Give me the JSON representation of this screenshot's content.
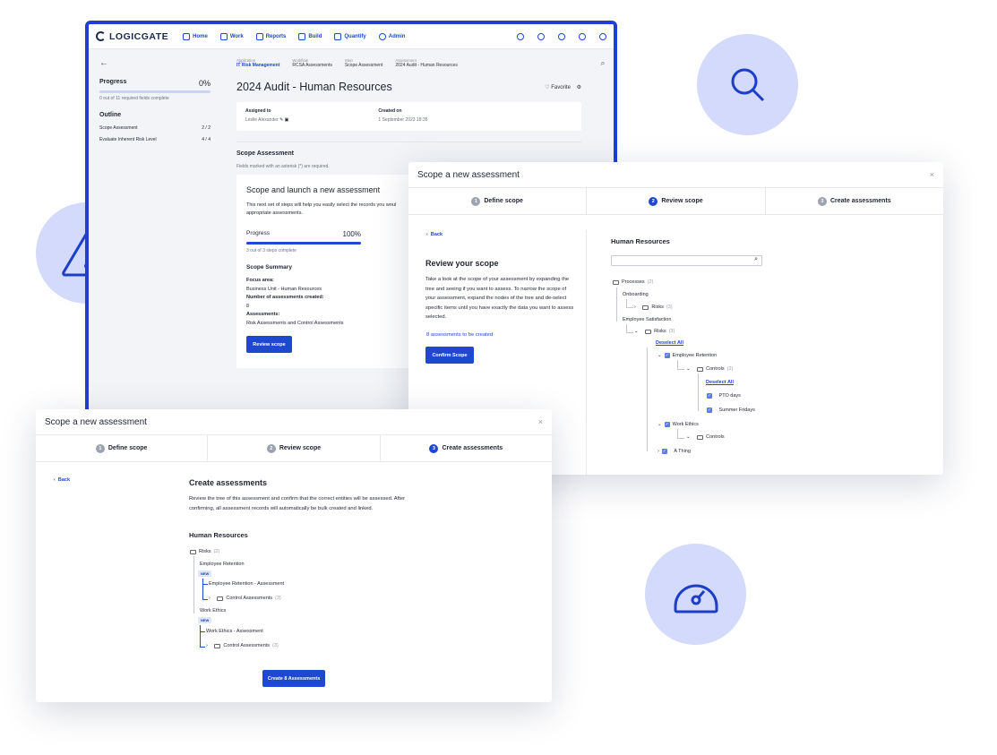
{
  "app": {
    "logo": "LOGICGATE",
    "nav": [
      "Home",
      "Work",
      "Reports",
      "Build",
      "Quantify",
      "Admin"
    ],
    "sidebar": {
      "progress_label": "Progress",
      "progress_pct": "0%",
      "progress_value": 0,
      "progress_sub": "0 out of 11 required fields complete",
      "outline_title": "Outline",
      "outline": [
        {
          "label": "Scope Assessment",
          "count": "2 / 2"
        },
        {
          "label": "Evaluate Inherent Risk Level",
          "count": "4 / 4"
        }
      ]
    },
    "breadcrumbs": [
      {
        "label": "Application",
        "value": "IT Risk Management"
      },
      {
        "label": "Workflow",
        "value": "RCSA Assessments"
      },
      {
        "label": "Step",
        "value": "Scope Assessment"
      },
      {
        "label": "Assessment",
        "value": "2024 Audit - Human Resources"
      }
    ],
    "record_title": "2024 Audit - Human Resources",
    "favorite_label": "Favorite",
    "assigned_label": "Assigned to",
    "assigned_value": "Leslie Alexander",
    "created_label": "Created on",
    "created_value": "1 September 2023 18:35",
    "section_title": "Scope Assessment",
    "required_note": "Fields marked with an asterisk (*) are required.",
    "launch": {
      "title": "Scope and launch a new assessment",
      "desc_1": "This next set of steps will help you easily select the records you woul",
      "desc_2": "appropriate assessments.",
      "progress_label": "Progress",
      "progress_pct": "100%",
      "progress_value": 1,
      "progress_sub": "3 out of 3 steps complete",
      "summary_title": "Scope Summary",
      "focus_label": "Focus area:",
      "focus_value": "Business Unit - Human Resources",
      "num_label": "Number of assessments created:",
      "num_value": "8",
      "assess_label": "Assessments:",
      "assess_value": "Risk Assessments and Control Assessments",
      "button": "Review scope"
    }
  },
  "review_modal": {
    "title": "Scope a new assessment",
    "close": "×",
    "steps": [
      {
        "num": "1",
        "label": "Define scope"
      },
      {
        "num": "2",
        "label": "Review scope"
      },
      {
        "num": "3",
        "label": "Create assessments"
      }
    ],
    "back": "Back",
    "heading": "Review your scope",
    "desc": "Take a look at the scope of your assessment by expanding the tree and seeing if you want to assess. To narrow the scope of your assessment, expand the nodes of the tree and de-select specific items until you have exactly the data you want to assess selected.",
    "count_link": "8 assessments to be created",
    "confirm_button": "Confirm Scope",
    "tree_title": "Human Resources",
    "tree": {
      "processes": "Processes",
      "processes_count": "(2)",
      "onboarding": "Onboarding",
      "risks": "Risks",
      "risks_count_a": "(3)",
      "employee_satisfaction": "Employee Satisfaction",
      "risks_count_b": "(3)",
      "deselect_all": "Deselect All",
      "employee_retention": "Employee Retention",
      "controls": "Controls",
      "controls_count": "(2)",
      "deselect_all_2": "Deselect All",
      "pto": "PTO days",
      "summer": "Summer Fridays",
      "work_ethics": "Work Ethics",
      "controls_b": "Controls",
      "a_thing": "A Thing"
    }
  },
  "create_modal": {
    "title": "Scope a new assessment",
    "close": "×",
    "steps": [
      {
        "num": "1",
        "label": "Define scope"
      },
      {
        "num": "2",
        "label": "Review scope"
      },
      {
        "num": "3",
        "label": "Create assessments"
      }
    ],
    "back": "Back",
    "heading": "Create assessments",
    "desc_1": "Review the tree of this assessment and confirm that the correct entities will be assessed. After",
    "desc_2": "confirming, all assessment records will automatically be bulk created and linked.",
    "tree_title": "Human Resources",
    "tree": {
      "risks": "Risks",
      "risks_count": "(2)",
      "er": "Employee Retention",
      "new_1": "NEW",
      "er_assess": "Employee Retention - Assessment",
      "ca_1": "Control Assessments",
      "ca_1_count": "(3)",
      "we": "Work Ethics",
      "new_2": "NEW",
      "we_assess": "Work Ethics - Assessment",
      "ca_2": "Control Assessments",
      "ca_2_count": "(3)"
    },
    "create_button": "Create 8 Assessments"
  },
  "accent_color": "#1e48cf",
  "icons": [
    "search-icon",
    "warning-icon",
    "gauge-icon"
  ]
}
